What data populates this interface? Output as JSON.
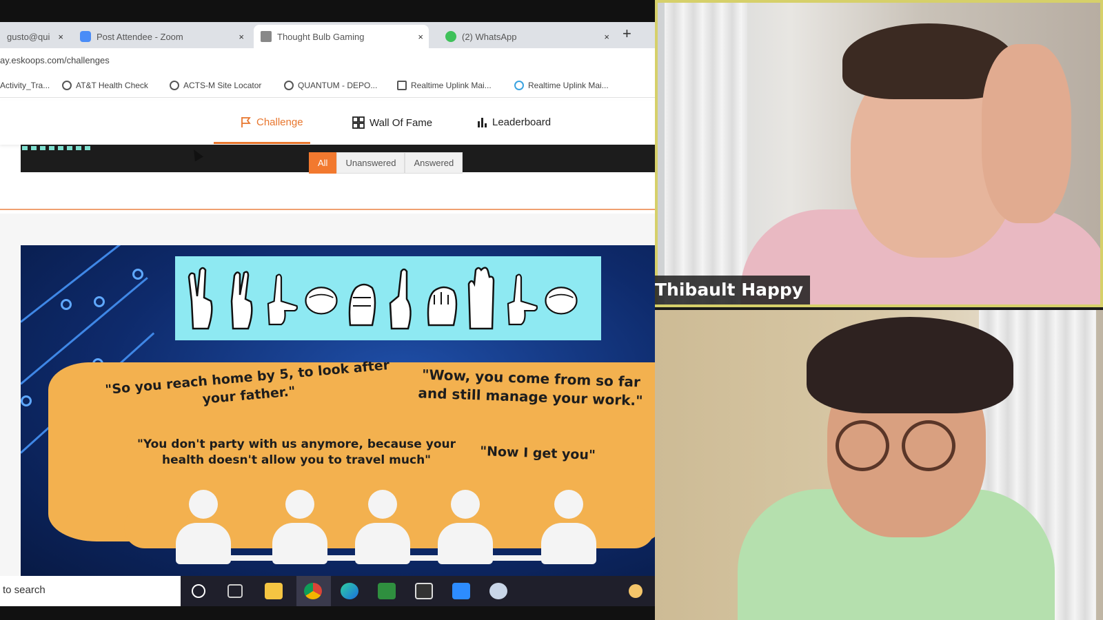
{
  "browser": {
    "tabs": [
      {
        "label": "gusto@qui",
        "icon": "mail-icon"
      },
      {
        "label": "Post Attendee - Zoom",
        "icon": "zoom-icon"
      },
      {
        "label": "Thought Bulb Gaming",
        "icon": "bulb-icon"
      },
      {
        "label": "(2) WhatsApp",
        "icon": "whatsapp-icon"
      }
    ],
    "new_tab_label": "+",
    "close_glyph": "×",
    "url": "ay.eskoops.com/challenges",
    "bookmarks": [
      {
        "label": "Activity_Tra..."
      },
      {
        "label": "AT&T Health Check"
      },
      {
        "label": "ACTS-M Site Locator"
      },
      {
        "label": "QUANTUM - DEPO..."
      },
      {
        "label": "Realtime Uplink Mai..."
      },
      {
        "label": "Realtime Uplink Mai..."
      }
    ]
  },
  "site_nav": {
    "items": [
      {
        "label": "Challenge",
        "icon": "flag-icon",
        "active": true
      },
      {
        "label": "Wall Of Fame",
        "icon": "grid-icon",
        "active": false
      },
      {
        "label": "Leaderboard",
        "icon": "bar-chart-icon",
        "active": false
      }
    ]
  },
  "filters": {
    "all": "All",
    "unanswered": "Unanswered",
    "answered": "Answered"
  },
  "poster": {
    "quote1": "\"So you reach home by 5, to look after your father.\"",
    "quote2": "\"Wow, you come from so far and still manage your work.\"",
    "quote3": "\"You don't party with us anymore, because your health doesn't allow you to travel much\"",
    "quote4": "\"Now I get you\""
  },
  "taskbar": {
    "search_text": "to search",
    "icons": [
      "cortana-icon",
      "task-view-icon",
      "file-explorer-icon",
      "chrome-icon",
      "edge-icon",
      "sheet-icon",
      "window-icon",
      "zoom-icon",
      "app-icon"
    ]
  },
  "participants": {
    "top_name": "Thibault Happy"
  },
  "colors": {
    "accent_orange": "#e8762d",
    "poster_blue": "#0e2a6b",
    "active_speaker_border": "#d6d06a"
  }
}
